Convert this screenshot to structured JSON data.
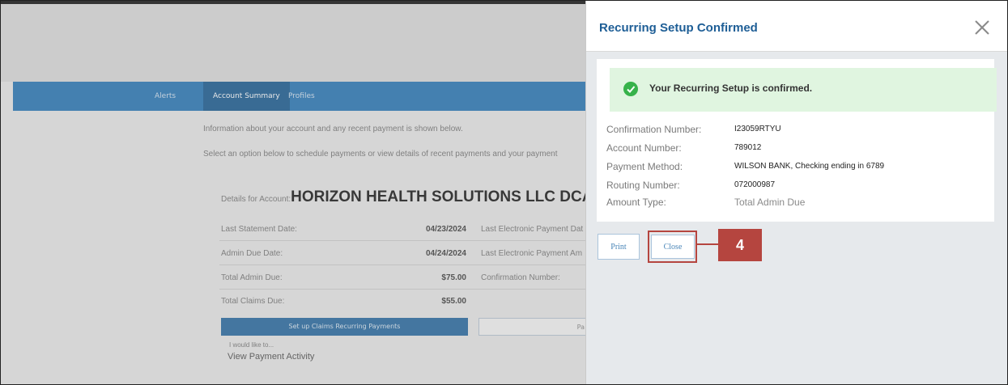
{
  "background_page": {
    "nav_items": [
      "Alerts",
      "Account Summary",
      "Profiles"
    ],
    "info_line_1": "Information about your account and any recent payment is shown below.",
    "info_line_2": "Select an option below to schedule payments or view details of recent payments and your payment",
    "account_prefix": "Details for Account:",
    "account_name": "HORIZON HEALTH SOLUTIONS LLC DCA I",
    "rows": [
      {
        "label": "Last Statement Date:",
        "value": "04/23/2024",
        "right_label": "Last Electronic Payment Dat"
      },
      {
        "label": "Admin Due Date:",
        "value": "04/24/2024",
        "right_label": "Last Electronic Payment Am"
      },
      {
        "label": "Total Admin Due:",
        "value": "$75.00",
        "right_label": "Confirmation Number:"
      },
      {
        "label": "Total Claims Due:",
        "value": "$55.00",
        "right_label": ""
      }
    ],
    "setup_button": "Set up Claims Recurring Payments",
    "pay_button": "Pa",
    "would_like": "I would like to...",
    "view_activity": "View Payment Activity"
  },
  "panel": {
    "title": "Recurring Setup Confirmed",
    "close_icon": "close-x-icon",
    "success_message": "Your Recurring Setup is confirmed.",
    "details": [
      {
        "label": "Confirmation Number:",
        "value": "I23059RTYU"
      },
      {
        "label": "Account Number:",
        "value": "789012"
      },
      {
        "label": "Payment Method:",
        "value": "WILSON BANK, Checking ending in 6789"
      },
      {
        "label": "Routing Number:",
        "value": "072000987"
      },
      {
        "label": "Amount Type:",
        "value": "Total Admin Due"
      }
    ],
    "print_button": "Print",
    "close_button": "Close",
    "step_badge": "4"
  },
  "colors": {
    "nav_blue": "#2d7ab8",
    "title_blue": "#1e5e96",
    "success_bg": "#e0f5e0",
    "check_green": "#36b24a",
    "callout_red": "#b5453f"
  }
}
